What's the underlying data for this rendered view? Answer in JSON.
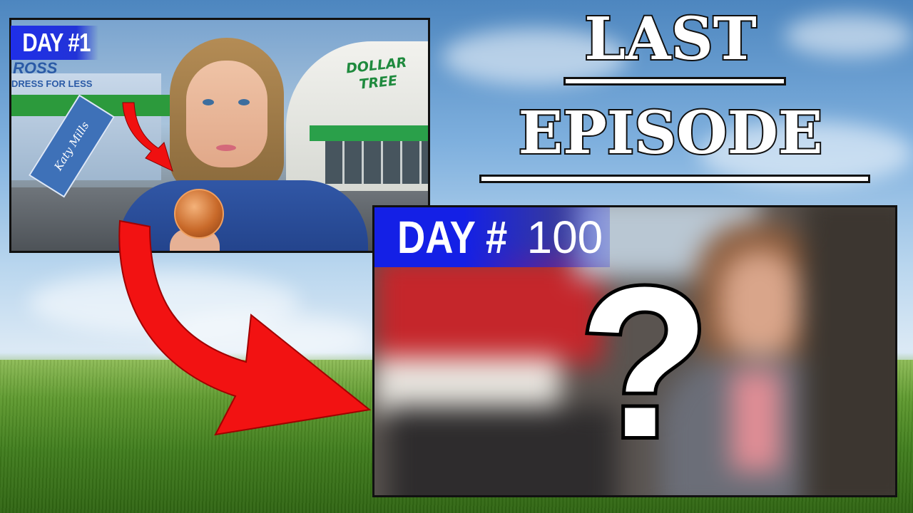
{
  "title": {
    "line1": "LAST",
    "line2": "EPISODE"
  },
  "thumbnail_left": {
    "badge": "DAY #1",
    "store_left_sign": "ROSS",
    "store_left_tagline": "DRESS FOR LESS",
    "mall_sign": "Katy Mills",
    "store_right_sign": "DOLLAR TREE"
  },
  "thumbnail_right": {
    "badge_prefix": "DAY #",
    "badge_number": "100",
    "mystery_symbol": "?"
  },
  "colors": {
    "badge_blue": "#1f2fe8",
    "arrow_red": "#f01010",
    "title_fill": "#ffffff",
    "outline": "#111111"
  }
}
